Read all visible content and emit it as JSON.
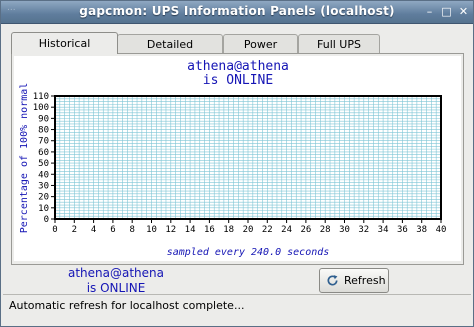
{
  "window": {
    "title": "gapcmon: UPS Information Panels (localhost)",
    "ghost_text": "...",
    "minimize_glyph": "–",
    "maximize_glyph": "□",
    "close_glyph": "✕"
  },
  "tabs": [
    {
      "label": "Historical Summary",
      "active": true
    },
    {
      "label": "Detailed Information",
      "active": false
    },
    {
      "label": "Power Events",
      "active": false
    },
    {
      "label": "Full UPS Status",
      "active": false
    }
  ],
  "chart_data": {
    "type": "line",
    "title": "athena@athena",
    "subtitle": "is ONLINE",
    "ylabel": "Percentage of 100% normal",
    "xlabel": "sampled every 240.0 seconds",
    "x_ticks": [
      "0",
      "2",
      "4",
      "6",
      "8",
      "10",
      "12",
      "14",
      "16",
      "18",
      "20",
      "22",
      "24",
      "26",
      "28",
      "30",
      "32",
      "34",
      "36",
      "38",
      "40"
    ],
    "y_ticks": [
      "0",
      "10",
      "20",
      "30",
      "40",
      "50",
      "60",
      "70",
      "80",
      "90",
      "100",
      "110"
    ],
    "xlim": [
      0,
      40
    ],
    "ylim": [
      0,
      110
    ],
    "grid": true,
    "series": [],
    "colors": {
      "text": "#1515b5",
      "grid": "#7fc6d6",
      "frame": "#000000"
    }
  },
  "footer": {
    "host": "athena@athena",
    "state": "is ONLINE",
    "refresh_label": "Refresh",
    "status_message": "Automatic refresh for localhost complete..."
  }
}
